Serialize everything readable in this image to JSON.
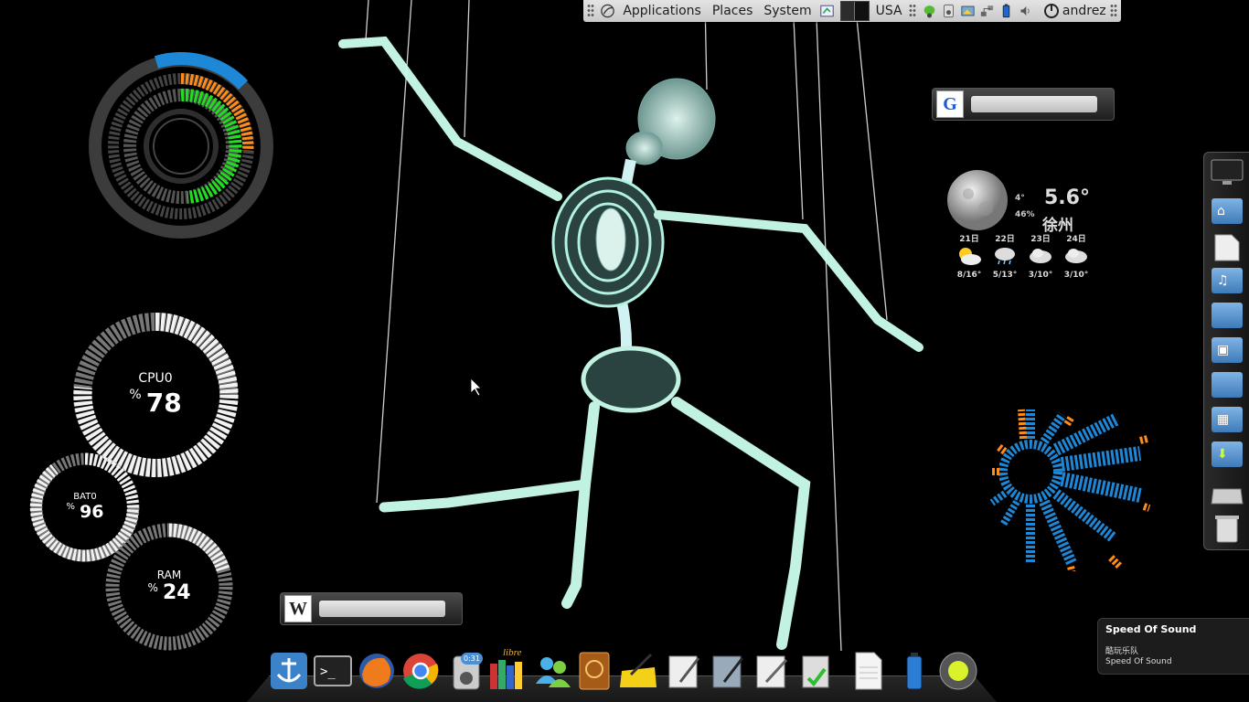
{
  "top_panel": {
    "applications": "Applications",
    "places": "Places",
    "system": "System",
    "keyboard_layout": "USA",
    "user": "andrez"
  },
  "gauges": {
    "cpu": {
      "label": "CPU0",
      "percent_sign": "%",
      "value": "78"
    },
    "battery": {
      "label": "BAT0",
      "percent_sign": "%",
      "value": "96"
    },
    "ram": {
      "label": "RAM",
      "percent_sign": "%",
      "value": "24"
    }
  },
  "weather": {
    "humidity_top": "4°",
    "humidity": "46%",
    "temperature": "5.6°",
    "city": "徐州",
    "forecast": [
      {
        "day": "21日",
        "range": "8/16°",
        "icon": "partly-sunny-icon"
      },
      {
        "day": "22日",
        "range": "5/13°",
        "icon": "rain-cloud-icon"
      },
      {
        "day": "23日",
        "range": "3/10°",
        "icon": "cloud-icon"
      },
      {
        "day": "24日",
        "range": "3/10°",
        "icon": "cloud-icon"
      }
    ]
  },
  "notification": {
    "title": "Speed Of Sound",
    "artist": "酷玩乐队",
    "track": "Speed Of Sound"
  },
  "dock": {
    "clock_badge": "0:31",
    "calibre_label": "libre"
  },
  "colors": {
    "accent_blue": "#1e88d8",
    "accent_orange": "#ff8c1a",
    "accent_green": "#22dd22",
    "panel_bg": "#d6d6d6"
  }
}
